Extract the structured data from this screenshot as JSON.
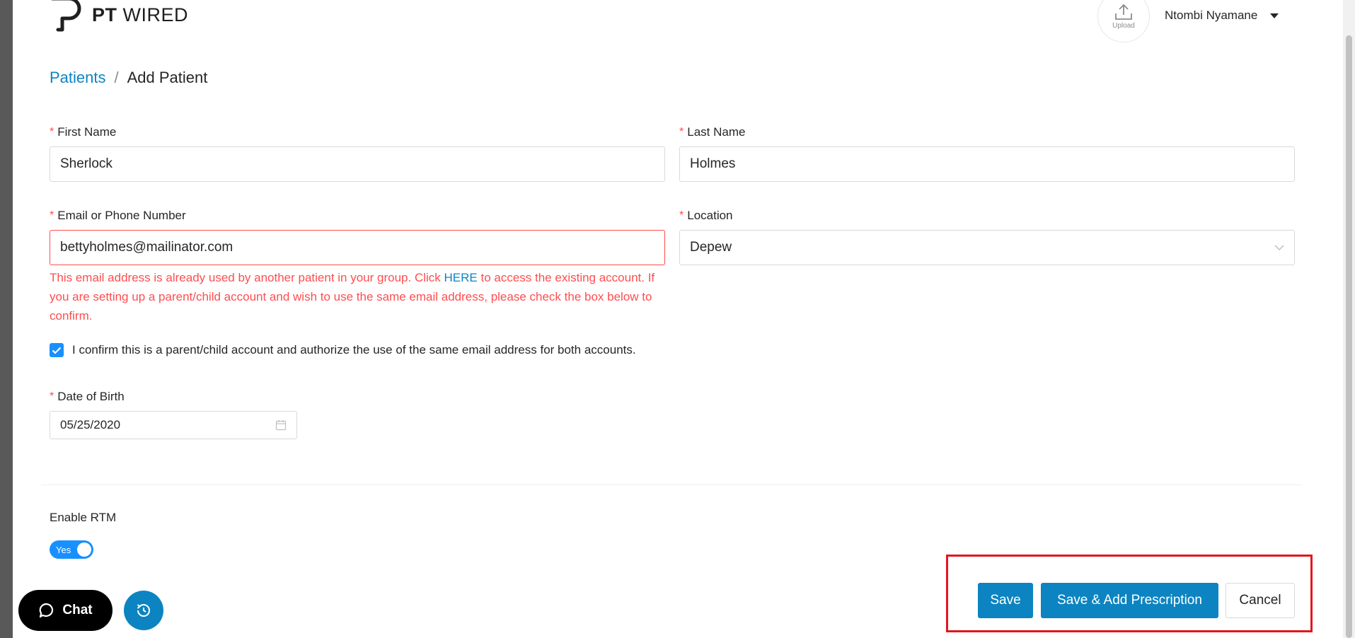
{
  "header": {
    "logo_bold": "PT",
    "logo_light": "WIRED",
    "upload_label": "Upload",
    "user_name": "Ntombi Nyamane"
  },
  "breadcrumb": {
    "parent": "Patients",
    "separator": "/",
    "current": "Add Patient"
  },
  "form": {
    "first_name": {
      "label": "First Name",
      "value": "Sherlock"
    },
    "last_name": {
      "label": "Last Name",
      "value": "Holmes"
    },
    "email": {
      "label": "Email or Phone Number",
      "value": "bettyholmes@mailinator.com",
      "error_part1": "This email address is already used by another patient in your group. Click ",
      "error_link": "HERE",
      "error_part2": " to access the existing account. If you are setting up a parent/child account and wish to use the same email address, please check the box below to confirm."
    },
    "location": {
      "label": "Location",
      "value": "Depew"
    },
    "confirm_text": "I confirm this is a parent/child account and authorize the use of the same email address for both accounts.",
    "confirm_checked": true,
    "dob": {
      "label": "Date of Birth",
      "value": "05/25/2020"
    },
    "rtm": {
      "label": "Enable RTM",
      "toggle_text": "Yes",
      "enabled": true
    },
    "required_mark": "*"
  },
  "actions": {
    "save": "Save",
    "save_add": "Save & Add Prescription",
    "cancel": "Cancel"
  },
  "floating": {
    "chat_label": "Chat"
  },
  "colors": {
    "primary": "#0c84c1",
    "error": "#ff4d4f",
    "highlight": "#e3161e",
    "toggle": "#1890ff"
  }
}
